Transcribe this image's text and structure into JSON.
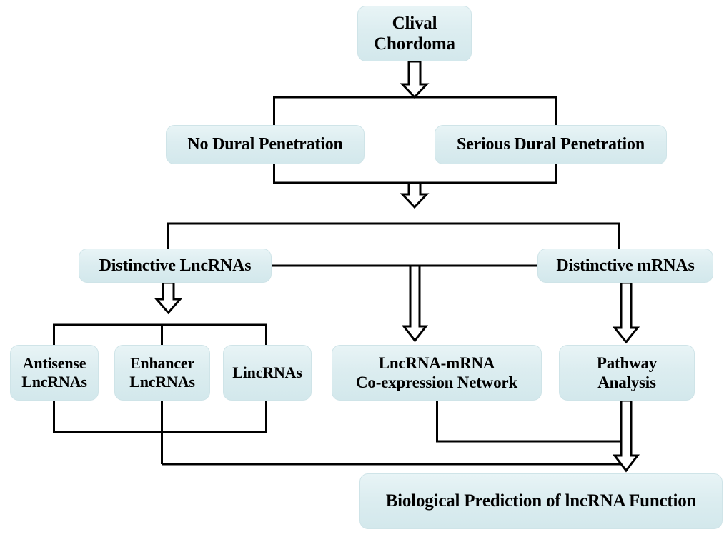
{
  "diagram": {
    "title": "Clival Chordoma lncRNA study workflow",
    "style": {
      "node_fill": "#dcedf0",
      "node_border": "#cfe4e8",
      "connector_color": "#000000",
      "text_color": "#000000",
      "background": "#ffffff"
    },
    "nodes": {
      "clival_chordoma": "Clival\nChordoma",
      "no_dural_penetration": "No Dural Penetration",
      "serious_dural_penetration": "Serious Dural Penetration",
      "distinctive_lncrnas": "Distinctive LncRNAs",
      "distinctive_mrnas": "Distinctive mRNAs",
      "antisense_lncrnas": "Antisense\nLncRNAs",
      "enhancer_lncrnas": "Enhancer\nLncRNAs",
      "lincrnas": "LincRNAs",
      "coexpression_network": "LncRNA-mRNA\nCo-expression Network",
      "pathway_analysis": "Pathway\nAnalysis",
      "biological_prediction": "Biological Prediction of lncRNA Function"
    },
    "edges": [
      {
        "from": "clival_chordoma",
        "to": "no_dural_penetration",
        "marker": "block-arrow-split"
      },
      {
        "from": "clival_chordoma",
        "to": "serious_dural_penetration",
        "marker": "block-arrow-split"
      },
      {
        "from": "no_dural_penetration",
        "to": "distinctive_lncrnas",
        "marker": "block-arrow-merge"
      },
      {
        "from": "serious_dural_penetration",
        "to": "distinctive_mrnas",
        "marker": "block-arrow-merge"
      },
      {
        "from": "distinctive_lncrnas",
        "to": "antisense_lncrnas",
        "marker": "block-arrow-split"
      },
      {
        "from": "distinctive_lncrnas",
        "to": "enhancer_lncrnas",
        "marker": "block-arrow-split"
      },
      {
        "from": "distinctive_lncrnas",
        "to": "lincrnas",
        "marker": "block-arrow-split"
      },
      {
        "from": "distinctive_lncrnas",
        "to": "coexpression_network",
        "marker": "block-arrow"
      },
      {
        "from": "distinctive_mrnas",
        "to": "coexpression_network",
        "marker": "block-arrow"
      },
      {
        "from": "distinctive_mrnas",
        "to": "pathway_analysis",
        "marker": "block-arrow"
      },
      {
        "from": "antisense_lncrnas",
        "to": "biological_prediction",
        "marker": "block-arrow-merge"
      },
      {
        "from": "enhancer_lncrnas",
        "to": "biological_prediction",
        "marker": "block-arrow-merge"
      },
      {
        "from": "lincrnas",
        "to": "biological_prediction",
        "marker": "block-arrow-merge"
      },
      {
        "from": "coexpression_network",
        "to": "biological_prediction",
        "marker": "block-arrow-merge"
      },
      {
        "from": "pathway_analysis",
        "to": "biological_prediction",
        "marker": "block-arrow-merge"
      }
    ]
  }
}
